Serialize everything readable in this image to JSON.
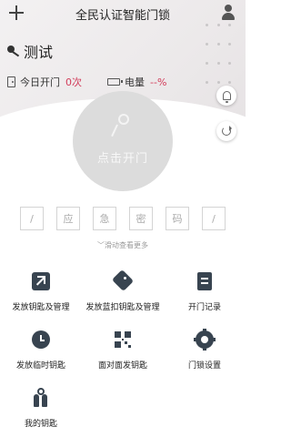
{
  "header": {
    "title": "全民认证智能门锁"
  },
  "lock": {
    "name": "测试"
  },
  "stats": {
    "today_open_label": "今日开门",
    "today_open_count": "0次",
    "battery_label": "电量",
    "battery_value": "--%"
  },
  "unlock": {
    "label": "点击开门"
  },
  "password_boxes": [
    "/",
    "应",
    "急",
    "密",
    "码",
    "/"
  ],
  "slide_hint": "滑动查看更多",
  "actions": [
    {
      "label": "发放钥匙及管理",
      "icon": "share-key-icon"
    },
    {
      "label": "发放蓝扣钥匙及管理",
      "icon": "tag-icon"
    },
    {
      "label": "开门记录",
      "icon": "record-icon"
    },
    {
      "label": "发放临时钥匙",
      "icon": "clock-icon"
    },
    {
      "label": "面对面发钥匙",
      "icon": "qr-code-icon"
    },
    {
      "label": "门锁设置",
      "icon": "gear-icon"
    },
    {
      "label": "我的钥匙",
      "icon": "keys-icon"
    }
  ],
  "colors": {
    "accent_red": "#d23c5a",
    "icon_dark": "#384450",
    "unlock_circle": "#dcdcdc"
  }
}
